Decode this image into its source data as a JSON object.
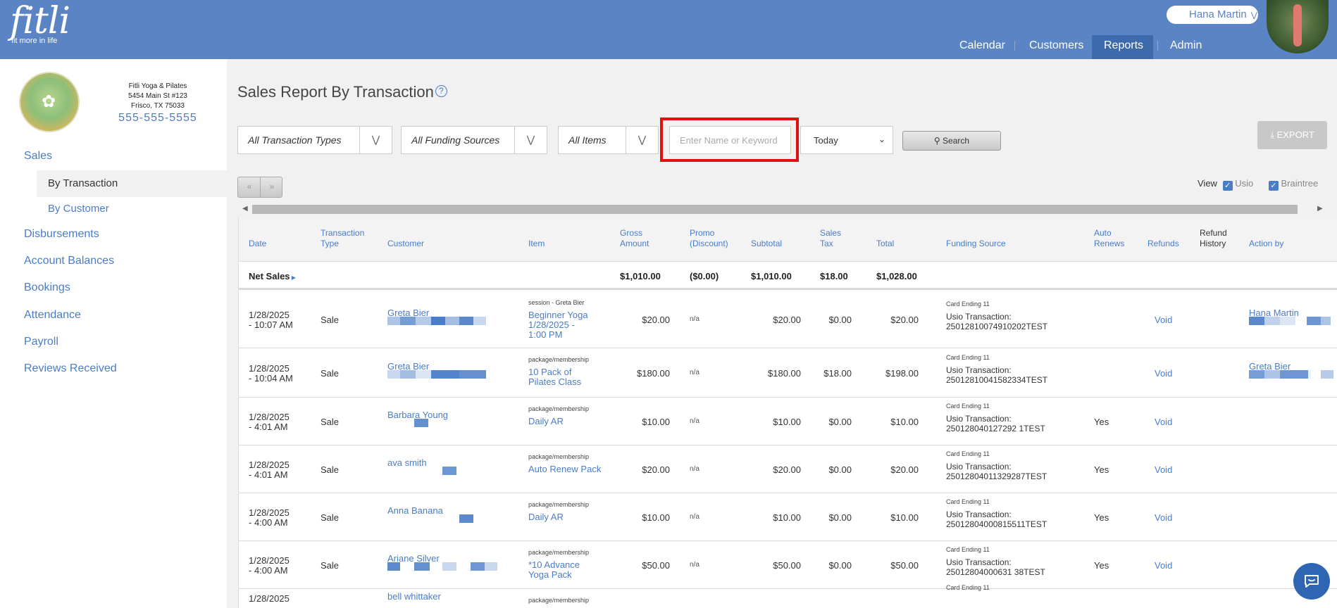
{
  "brand": {
    "name": "fitli",
    "tagline": "fit more in life"
  },
  "user": {
    "name": "Hana Martin"
  },
  "nav": [
    {
      "label": "Calendar",
      "active": false
    },
    {
      "label": "Customers",
      "active": false
    },
    {
      "label": "Reports",
      "active": true
    },
    {
      "label": "Admin",
      "active": false
    }
  ],
  "studio": {
    "name": "Fitli Yoga & Pilates",
    "address1": "5454 Main St #123",
    "address2": "Frisco, TX 75033",
    "phone": "555-555-5555",
    "logo_text": "FITLI YOGA & PILATES"
  },
  "sidebar": {
    "sales": "Sales",
    "sub": [
      {
        "label": "By Transaction",
        "active": true
      },
      {
        "label": "By Customer",
        "active": false
      }
    ],
    "items": [
      "Disbursements",
      "Account Balances",
      "Bookings",
      "Attendance",
      "Payroll",
      "Reviews Received"
    ]
  },
  "page": {
    "title": "Sales Report By Transaction",
    "help_icon": "?"
  },
  "filters": {
    "transaction_types": "All Transaction Types",
    "funding_sources": "All Funding Sources",
    "items": "All Items",
    "keyword_placeholder": "Enter Name or Keyword",
    "date_range": "Today",
    "search_label": "Search",
    "export_label": "EXPORT"
  },
  "pager": {
    "prev": "«",
    "next": "»"
  },
  "view": {
    "label": "View",
    "options": [
      {
        "label": "Usio",
        "checked": true
      },
      {
        "label": "Braintree",
        "checked": true
      }
    ]
  },
  "colors": {
    "header": "#5b84c4",
    "link": "#4a7cc7",
    "nav_active": "#3d6aad",
    "highlight": "#e01010",
    "redact": "#5b84c4"
  },
  "table": {
    "headers": [
      {
        "line1": "",
        "line2": "Date"
      },
      {
        "line1": "Transaction",
        "line2": "Type"
      },
      {
        "line1": "",
        "line2": "Customer"
      },
      {
        "line1": "",
        "line2": "Item"
      },
      {
        "line1": "Gross",
        "line2": "Amount"
      },
      {
        "line1": "Promo",
        "line2": "(Discount)"
      },
      {
        "line1": "",
        "line2": "Subtotal"
      },
      {
        "line1": "Sales",
        "line2": "Tax"
      },
      {
        "line1": "",
        "line2": "Total"
      },
      {
        "line1": "",
        "line2": "Funding Source"
      },
      {
        "line1": "Auto",
        "line2": "Renews"
      },
      {
        "line1": "",
        "line2": "Refunds"
      },
      {
        "line1": "Refund",
        "line2": "History"
      },
      {
        "line1": "",
        "line2": "Action by"
      }
    ],
    "net_sales": {
      "label": "Net Sales",
      "gross": "$1,010.00",
      "promo": "($0.00)",
      "subtotal": "$1,010.00",
      "tax": "$18.00",
      "total": "$1,028.00"
    },
    "rows": [
      {
        "date1": "1/28/2025",
        "date2": "- 10:07 AM",
        "type": "Sale",
        "customer": "Greta Bier",
        "item_kind": "session - Greta Bier",
        "item1": "Beginner Yoga",
        "item2": "1/28/2025 -",
        "item3": "1:00 PM",
        "gross": "$20.00",
        "promo": "n/a",
        "subtotal": "$20.00",
        "tax": "$0.00",
        "total": "$20.00",
        "funding1": "Card Ending 11",
        "funding2": "Usio Transaction:",
        "funding3": "25012810074910202TEST",
        "auto": "",
        "refund": "Void",
        "action_by": "Hana Martin"
      },
      {
        "date1": "1/28/2025",
        "date2": "- 10:04 AM",
        "type": "Sale",
        "customer": "Greta Bier",
        "item_kind": "package/membership",
        "item1": "10 Pack of",
        "item2": "Pilates Class",
        "item3": "",
        "gross": "$180.00",
        "promo": "n/a",
        "subtotal": "$180.00",
        "tax": "$18.00",
        "total": "$198.00",
        "funding1": "Card Ending 11",
        "funding2": "Usio Transaction:",
        "funding3": "25012810041582334TEST",
        "auto": "",
        "refund": "Void",
        "action_by": "Greta Bier"
      },
      {
        "date1": "1/28/2025",
        "date2": "- 4:01 AM",
        "type": "Sale",
        "customer": "Barbara Young",
        "item_kind": "package/membership",
        "item1": "Daily AR",
        "item2": "",
        "item3": "",
        "gross": "$10.00",
        "promo": "n/a",
        "subtotal": "$10.00",
        "tax": "$0.00",
        "total": "$10.00",
        "funding1": "Card Ending 11",
        "funding2": "Usio Transaction:",
        "funding3": "250128040127292 1TEST",
        "auto": "Yes",
        "refund": "Void",
        "action_by": ""
      },
      {
        "date1": "1/28/2025",
        "date2": "- 4:01 AM",
        "type": "Sale",
        "customer": "ava smith",
        "item_kind": "package/membership",
        "item1": "Auto Renew Pack",
        "item2": "",
        "item3": "",
        "gross": "$20.00",
        "promo": "n/a",
        "subtotal": "$20.00",
        "tax": "$0.00",
        "total": "$20.00",
        "funding1": "Card Ending 11",
        "funding2": "Usio Transaction:",
        "funding3": "25012804011329287TEST",
        "auto": "Yes",
        "refund": "Void",
        "action_by": ""
      },
      {
        "date1": "1/28/2025",
        "date2": "- 4:00 AM",
        "type": "Sale",
        "customer": "Anna Banana",
        "item_kind": "package/membership",
        "item1": "Daily AR",
        "item2": "",
        "item3": "",
        "gross": "$10.00",
        "promo": "n/a",
        "subtotal": "$10.00",
        "tax": "$0.00",
        "total": "$10.00",
        "funding1": "Card Ending 11",
        "funding2": "Usio Transaction:",
        "funding3": "25012804000815511TEST",
        "auto": "Yes",
        "refund": "Void",
        "action_by": ""
      },
      {
        "date1": "1/28/2025",
        "date2": "- 4:00 AM",
        "type": "Sale",
        "customer": "Ariane Silver",
        "item_kind": "package/membership",
        "item1": "*10 Advance",
        "item2": "Yoga Pack",
        "item3": "",
        "gross": "$50.00",
        "promo": "n/a",
        "subtotal": "$50.00",
        "tax": "$0.00",
        "total": "$50.00",
        "funding1": "Card Ending 11",
        "funding2": "Usio Transaction:",
        "funding3": "25012804000631 38TEST",
        "auto": "Yes",
        "refund": "Void",
        "action_by": ""
      },
      {
        "date1": "1/28/2025",
        "date2": "",
        "type": "",
        "customer": "bell whittaker",
        "item_kind": "package/membership",
        "item1": "",
        "item2": "",
        "item3": "",
        "gross": "",
        "promo": "",
        "subtotal": "",
        "tax": "",
        "total": "",
        "funding1": "Card Ending 11",
        "funding2": "",
        "funding3": "",
        "auto": "",
        "refund": "",
        "action_by": ""
      }
    ]
  }
}
